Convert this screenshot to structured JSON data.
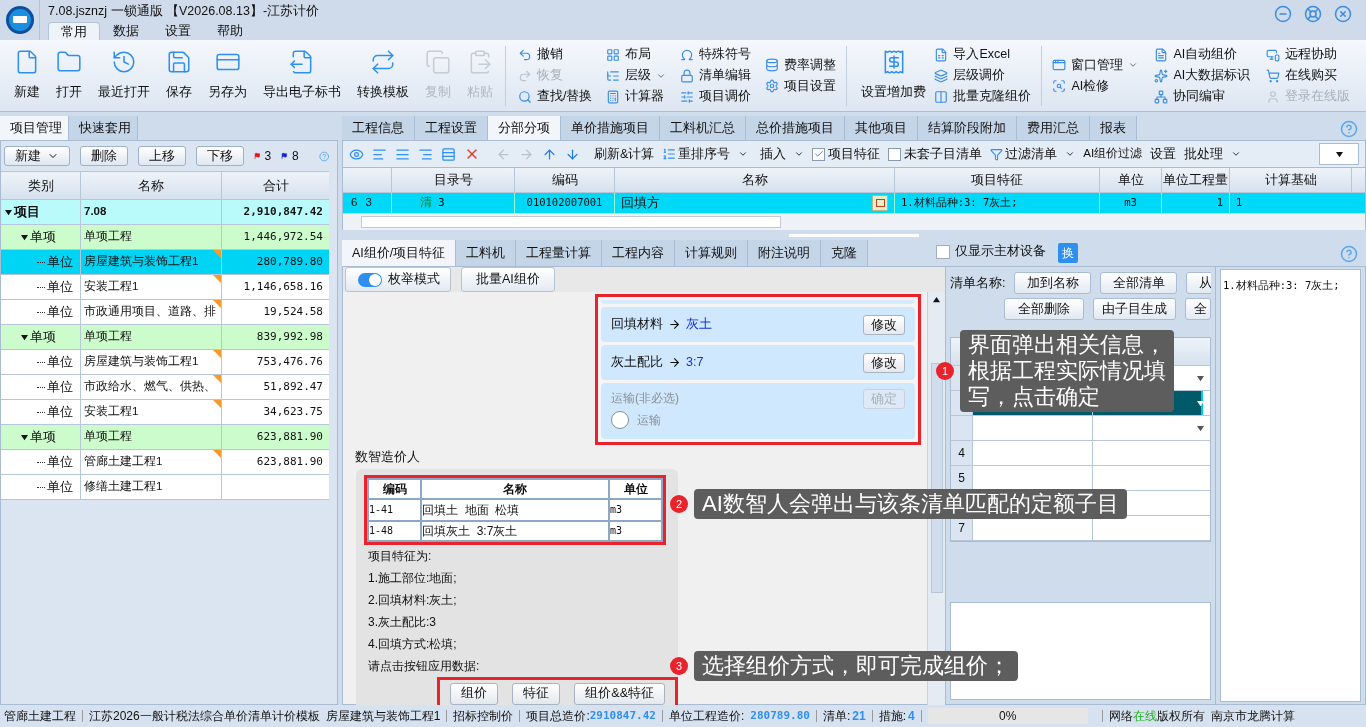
{
  "window": {
    "title": "7.08.jsznzj 一锁通版 【V2026.08.13】-江苏计价"
  },
  "menu_tabs": [
    {
      "label": "常用",
      "selected": true
    },
    {
      "label": "数据",
      "selected": false
    },
    {
      "label": "设置",
      "selected": false
    },
    {
      "label": "帮助",
      "selected": false
    }
  ],
  "ribbon": {
    "large": [
      {
        "label": "新建",
        "disabled": false
      },
      {
        "label": "打开",
        "disabled": false
      },
      {
        "label": "最近打开",
        "disabled": false
      },
      {
        "label": "保存",
        "disabled": false
      },
      {
        "label": "另存为",
        "disabled": false
      },
      {
        "label": "导出电子标书",
        "disabled": false
      },
      {
        "label": "转换模板",
        "disabled": false
      },
      {
        "label": "复制",
        "disabled": true
      },
      {
        "label": "粘贴",
        "disabled": true
      }
    ],
    "columns_a": [
      [
        {
          "label": "撤销",
          "disabled": false
        },
        {
          "label": "恢复",
          "disabled": true
        },
        {
          "label": "查找/替换",
          "disabled": false
        }
      ],
      [
        {
          "label": "布局",
          "disabled": false
        },
        {
          "label": "层级",
          "disabled": false,
          "dropdown": true
        },
        {
          "label": "计算器",
          "disabled": false
        }
      ],
      [
        {
          "label": "特殊符号",
          "disabled": false
        },
        {
          "label": "清单编辑",
          "disabled": false
        },
        {
          "label": "项目调价",
          "disabled": false
        }
      ],
      [
        {
          "label": "费率调整",
          "disabled": false
        },
        {
          "label": "项目设置",
          "disabled": false
        }
      ]
    ],
    "fee_button": "设置增加费",
    "columns_b": [
      [
        {
          "label": "导入Excel",
          "disabled": false
        },
        {
          "label": "层级调价",
          "disabled": false
        },
        {
          "label": "批量克隆组价",
          "disabled": false
        }
      ]
    ],
    "columns_c": [
      [
        {
          "label": "窗口管理",
          "disabled": false,
          "dropdown": true
        },
        {
          "label": "AI检修",
          "disabled": false
        }
      ],
      [
        {
          "label": "AI自动组价",
          "disabled": false
        },
        {
          "label": "AI大数据标识",
          "disabled": false
        },
        {
          "label": "协同编审",
          "disabled": false
        }
      ],
      [
        {
          "label": "远程协助",
          "disabled": false
        },
        {
          "label": "在线购买",
          "disabled": false
        },
        {
          "label": "登录在线版",
          "disabled": true
        }
      ]
    ]
  },
  "left_panel": {
    "tabs": [
      {
        "label": "项目管理",
        "selected": true
      },
      {
        "label": "快速套用",
        "selected": false
      }
    ],
    "toolbar": {
      "new": "新建",
      "delete": "删除",
      "up": "上移",
      "down": "下移",
      "red_flags": "3",
      "blue_flags": "8"
    },
    "columns": [
      "类别",
      "名称",
      "合计"
    ],
    "tree": [
      {
        "category": "项目",
        "name": "7.08",
        "total": "2,910,847.42",
        "expanded": true,
        "marked": false,
        "selected": false,
        "children": [
          {
            "category": "单项",
            "name": "单项工程",
            "total": "1,446,972.54",
            "expanded": true,
            "marked": false,
            "selected": false,
            "children": [
              {
                "category": "单位",
                "name": "房屋建筑与装饰工程1",
                "total": "280,789.80",
                "marked": true,
                "selected": true
              },
              {
                "category": "单位",
                "name": "安装工程1",
                "total": "1,146,658.16",
                "marked": true,
                "selected": false
              },
              {
                "category": "单位",
                "name": "市政通用项目、道路、排",
                "total": "19,524.58",
                "marked": true,
                "selected": false
              }
            ]
          },
          {
            "category": "单项",
            "name": "单项工程",
            "total": "839,992.98",
            "expanded": true,
            "marked": false,
            "selected": false,
            "children": [
              {
                "category": "单位",
                "name": "房屋建筑与装饰工程1",
                "total": "753,476.76",
                "marked": true,
                "selected": false
              },
              {
                "category": "单位",
                "name": "市政给水、燃气、供热、",
                "total": "51,892.47",
                "marked": true,
                "selected": false
              },
              {
                "category": "单位",
                "name": "安装工程1",
                "total": "34,623.75",
                "marked": true,
                "selected": false
              }
            ]
          },
          {
            "category": "单项",
            "name": "单项工程",
            "total": "623,881.90",
            "expanded": true,
            "marked": false,
            "selected": false,
            "children": [
              {
                "category": "单位",
                "name": "管廊土建工程1",
                "total": "623,881.90",
                "marked": true,
                "selected": false
              },
              {
                "category": "单位",
                "name": "修缮土建工程1",
                "marked": false,
                "selected": false
              }
            ]
          }
        ]
      }
    ]
  },
  "main_tabs": [
    {
      "label": "工程信息",
      "selected": false
    },
    {
      "label": "工程设置",
      "selected": false
    },
    {
      "label": "分部分项",
      "selected": true
    },
    {
      "label": "单价措施项目",
      "selected": false
    },
    {
      "label": "工料机汇总",
      "selected": false
    },
    {
      "label": "总价措施项目",
      "selected": false
    },
    {
      "label": "其他项目",
      "selected": false
    },
    {
      "label": "结算阶段附加",
      "selected": false
    },
    {
      "label": "费用汇总",
      "selected": false
    },
    {
      "label": "报表",
      "selected": false
    }
  ],
  "toolbar": {
    "refresh": "刷新&计算",
    "renumber": "重排序号",
    "insert": "插入",
    "feature_check": {
      "label": "项目特征",
      "checked": true
    },
    "unmatched_check": {
      "label": "未套子目清单",
      "checked": false
    },
    "filter": "过滤清单",
    "ai_filter": "AI组价过滤",
    "settings": "设置",
    "batch": "批处理"
  },
  "grid": {
    "columns": [
      "目录号",
      "编码",
      "名称",
      "项目特征",
      "单位",
      "单位工程量",
      "计算基础"
    ],
    "rows": [
      {
        "row_no": "6",
        "level": "3",
        "type": "清",
        "catalog": "3",
        "code": "010102007001",
        "name": "回填方",
        "feature": "1.材料品种:3: 7灰土;",
        "unit": "m3",
        "quantity": "1",
        "base": "1",
        "selected": true
      }
    ]
  },
  "detail_tabs": [
    {
      "label": "AI组价/项目特征",
      "selected": true
    },
    {
      "label": "工料机",
      "selected": false
    },
    {
      "label": "工程量计算",
      "selected": false
    },
    {
      "label": "工程内容",
      "selected": false
    },
    {
      "label": "计算规则",
      "selected": false
    },
    {
      "label": "附注说明",
      "selected": false
    },
    {
      "label": "克隆",
      "selected": false
    }
  ],
  "main_material_only": {
    "label": "仅显示主材设备",
    "checked": false
  },
  "swap_button": "换",
  "ai_panel": {
    "enum_mode": {
      "label": "枚举模式",
      "on": true
    },
    "batch_button": "批量AI组价",
    "features": [
      {
        "kind": "set",
        "label": "回填材料",
        "value": "灰土",
        "button": "修改"
      },
      {
        "kind": "set",
        "label": "灰土配比",
        "value": "3:7",
        "button": "修改"
      },
      {
        "kind": "optional",
        "label": "运输(非必选)",
        "option": "运输",
        "checked": false,
        "button": "确定"
      }
    ],
    "assistant_title": "数智造价人",
    "quota_columns": [
      "编码",
      "名称",
      "单位"
    ],
    "quota_rows": [
      [
        "1-41",
        "回填土  地面  松填",
        "m3"
      ],
      [
        "1-48",
        "回填灰土  3:7灰土",
        "m3"
      ]
    ],
    "lines": [
      "项目特征为:",
      "1.施工部位:地面;",
      "2.回填材料:灰土;",
      "3.灰土配比:3",
      "4.回填方式:松填;",
      "请点击按钮应用数据:"
    ],
    "buttons": [
      "组价",
      "特征",
      "组价&&特征"
    ]
  },
  "list_panel": {
    "label": "清单名称:",
    "buttons_row1": [
      "加到名称",
      "全部清单",
      "从"
    ],
    "buttons_row2": [
      "全部删除",
      "由子目生成",
      "全"
    ],
    "rows": [
      {
        "dropdown": true,
        "selected": false
      },
      {
        "dropdown": true,
        "selected": true
      },
      {
        "dropdown": true,
        "selected": false
      },
      {
        "no": "4",
        "dropdown": false,
        "selected": false
      },
      {
        "no": "5",
        "dropdown": false,
        "selected": false
      },
      {
        "dropdown": false,
        "selected": false
      },
      {
        "no": "7",
        "dropdown": false,
        "selected": false
      }
    ]
  },
  "feature_text": "1.材料品种:3: 7灰土;",
  "callouts": [
    {
      "number": "1",
      "lines": [
        "界面弹出相关信息，",
        "根据工程实际情况填",
        "写，点击确定"
      ]
    },
    {
      "number": "2",
      "lines": [
        "AI数智人会弹出与该条清单匹配的定额子目"
      ]
    },
    {
      "number": "3",
      "lines": [
        "选择组价方式，即可完成组价；"
      ]
    }
  ],
  "status_bar": {
    "project": "管廊土建工程",
    "template": "江苏2026一般计税法综合单价清单计价模板",
    "unit": "房屋建筑与装饰工程1",
    "mode": "招标控制价",
    "total_label": "项目总造价:",
    "total": "2910847.42",
    "unit_total_label": "单位工程造价:",
    "unit_total": "280789.80",
    "list_label": "清单:",
    "list_count": "21",
    "measure_label": "措施:",
    "measure_count": "4",
    "progress": {
      "label": "0%",
      "level": 0
    },
    "network_prefix": "网络",
    "network_status": "在线",
    "copyright": "版权所有",
    "company": "南京市龙腾计算"
  }
}
